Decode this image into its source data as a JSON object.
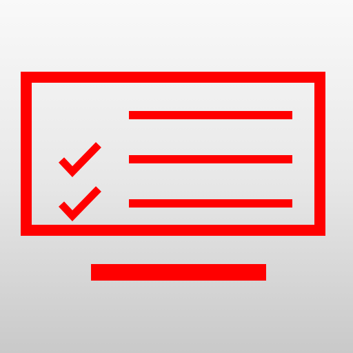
{
  "icon": {
    "name": "tv-checklist-icon",
    "accent_color": "#ff0000",
    "checklist": {
      "lines": 3,
      "checked_lines": 2
    }
  }
}
